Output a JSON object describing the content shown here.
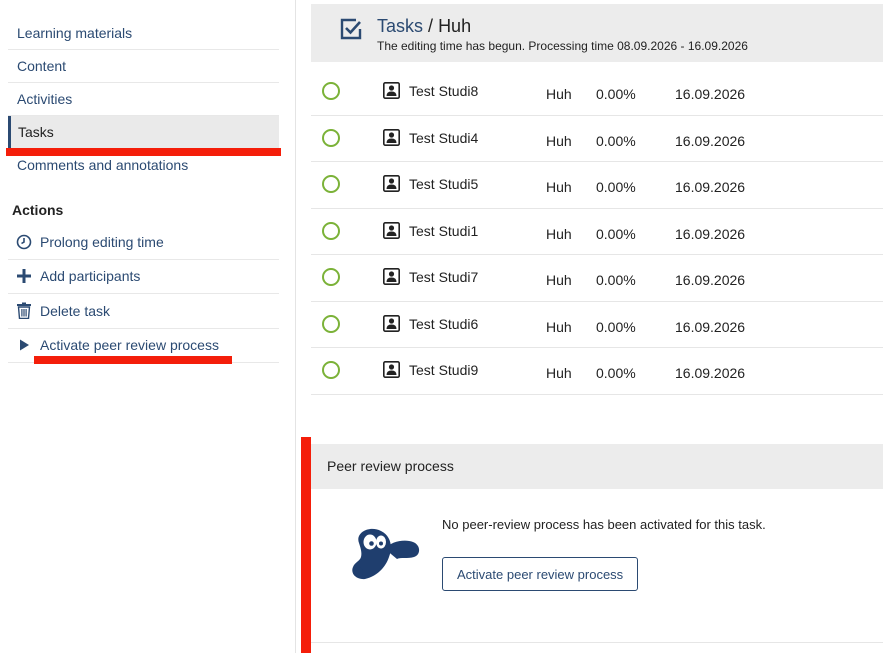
{
  "sidebar": {
    "nav": [
      {
        "label": "Learning materials"
      },
      {
        "label": "Content"
      },
      {
        "label": "Activities"
      },
      {
        "label": "Tasks"
      },
      {
        "label": "Comments and annotations"
      }
    ],
    "actions_title": "Actions",
    "actions": [
      {
        "label": "Prolong editing time",
        "icon": "clock-icon"
      },
      {
        "label": "Add participants",
        "icon": "plus-icon"
      },
      {
        "label": "Delete task",
        "icon": "trash-icon"
      },
      {
        "label": "Activate peer review process",
        "icon": "triangle-right-icon"
      }
    ]
  },
  "task": {
    "link": "Tasks",
    "separator": "/",
    "name": "Huh",
    "subtitle": "The editing time has begun. Processing time 08.09.2026 - 16.09.2026"
  },
  "table": {
    "rows": [
      {
        "name": "Test Studi8",
        "title": "Huh",
        "percent": "0.00%",
        "date": "16.09.2026"
      },
      {
        "name": "Test Studi4",
        "title": "Huh",
        "percent": "0.00%",
        "date": "16.09.2026"
      },
      {
        "name": "Test Studi5",
        "title": "Huh",
        "percent": "0.00%",
        "date": "16.09.2026"
      },
      {
        "name": "Test Studi1",
        "title": "Huh",
        "percent": "0.00%",
        "date": "16.09.2026"
      },
      {
        "name": "Test Studi7",
        "title": "Huh",
        "percent": "0.00%",
        "date": "16.09.2026"
      },
      {
        "name": "Test Studi6",
        "title": "Huh",
        "percent": "0.00%",
        "date": "16.09.2026"
      },
      {
        "name": "Test Studi9",
        "title": "Huh",
        "percent": "0.00%",
        "date": "16.09.2026"
      }
    ]
  },
  "peer": {
    "title": "Peer review process",
    "message": "No peer-review process has been activated for this task.",
    "button": "Activate peer review process"
  },
  "colors": {
    "link": "#2b4a72",
    "highlight": "#f41e0a",
    "radio": "#7bb238",
    "panel_bg": "#ececec"
  }
}
